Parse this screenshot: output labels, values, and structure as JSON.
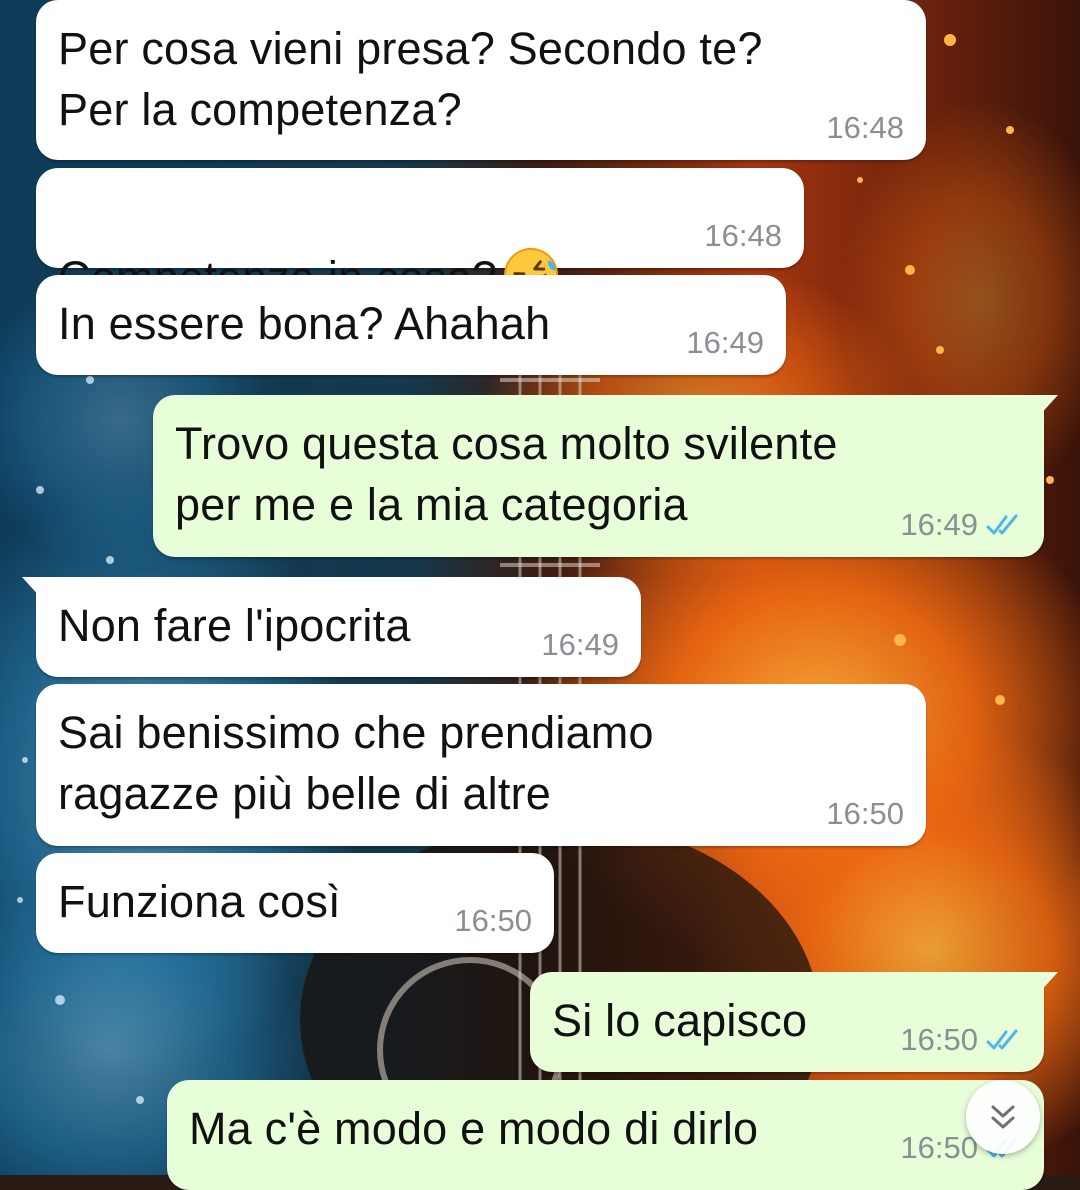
{
  "messages": [
    {
      "direction": "in",
      "text": "Per cosa vieni presa? Secondo te?\nPer la competenza?",
      "time": "16:48"
    },
    {
      "direction": "in",
      "text": "Competenza in cosa?",
      "emoji": "rolling-on-floor-laughing",
      "time": "16:48"
    },
    {
      "direction": "in",
      "text": "In essere bona? Ahahah",
      "time": "16:49"
    },
    {
      "direction": "out",
      "text": "Trovo questa cosa molto svilente\nper me e la mia categoria",
      "time": "16:49",
      "status": "read"
    },
    {
      "direction": "in",
      "text": "Non fare l'ipocrita",
      "time": "16:49"
    },
    {
      "direction": "in",
      "text": "Sai benissimo che prendiamo\nragazze più belle di altre",
      "time": "16:50"
    },
    {
      "direction": "in",
      "text": "Funziona così",
      "time": "16:50"
    },
    {
      "direction": "out",
      "text": "Si lo capisco",
      "time": "16:50",
      "status": "read"
    },
    {
      "direction": "out",
      "text": "Ma c'è modo e modo di dirlo",
      "time": "16:50",
      "status": "read"
    }
  ],
  "colors": {
    "incoming_bubble": "#ffffff",
    "outgoing_bubble": "#e7fed8",
    "read_ticks": "#4fb6ec",
    "time_text": "#8a8f93"
  },
  "icons": {
    "scroll_down": "double-chevron-down-icon",
    "read_receipt": "double-check-icon"
  }
}
